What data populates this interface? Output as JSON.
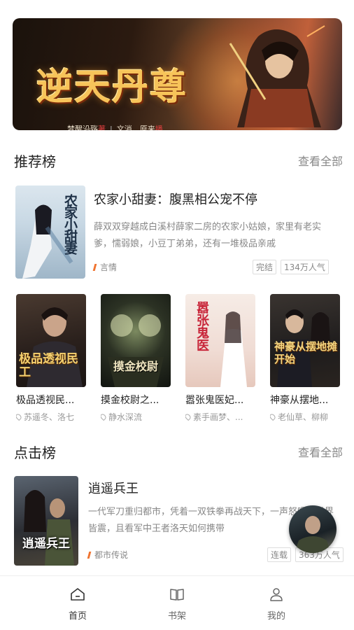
{
  "banner": {
    "title": "逆天丹尊",
    "author": "梦醒沿殇",
    "author_badge": "著",
    "narrators": "文消、原来",
    "narrator_badge": "播",
    "dots": 2,
    "active_dot": 0
  },
  "recommend": {
    "title": "推荐榜",
    "see_all": "查看全部",
    "featured": {
      "title": "农家小甜妻：腹黑相公宠不停",
      "desc": "薛双双穿越成白溪村薛家二房的农家小姑娘，家里有老实爹，懦弱娘，小豆丁弟弟，还有一堆极品亲戚",
      "category": "言情",
      "status": "完结",
      "popularity": "134万人气",
      "cover_text": "农家小甜妻"
    },
    "grid": [
      {
        "title": "极品透视民...",
        "author": "苏遥冬、洛七",
        "cover_text": "极品透视民工"
      },
      {
        "title": "摸金校尉之...",
        "author": "静水深流",
        "cover_text": "摸金校尉"
      },
      {
        "title": "嚣张鬼医妃...",
        "author": "素手画梦、...",
        "cover_text": "嚣张鬼医"
      },
      {
        "title": "神豪从摆地...",
        "author": "老仙草、柳柳",
        "cover_text": "神豪从摆地摊开始"
      }
    ]
  },
  "clicks": {
    "title": "点击榜",
    "see_all": "查看全部",
    "featured": {
      "title": "逍遥兵王",
      "desc": "一代军刀重归都市，凭着一双铁拳再战天下，一声怒喝，世界皆震，且看军中王者洛天如何携带",
      "category": "都市传说",
      "status": "连载",
      "popularity": "363万人气",
      "cover_text": "逍遥兵王"
    }
  },
  "nav": [
    {
      "label": "首页",
      "icon": "home-icon"
    },
    {
      "label": "书架",
      "icon": "book-icon"
    },
    {
      "label": "我的",
      "icon": "user-icon"
    }
  ]
}
